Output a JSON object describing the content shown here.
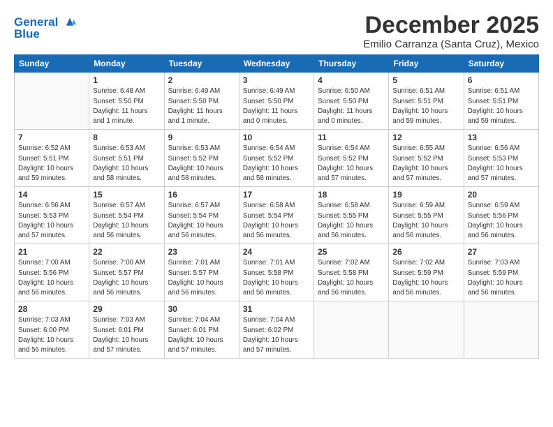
{
  "logo": {
    "line1": "General",
    "line2": "Blue"
  },
  "title": "December 2025",
  "subtitle": "Emilio Carranza (Santa Cruz), Mexico",
  "weekdays": [
    "Sunday",
    "Monday",
    "Tuesday",
    "Wednesday",
    "Thursday",
    "Friday",
    "Saturday"
  ],
  "weeks": [
    [
      {
        "day": "",
        "info": ""
      },
      {
        "day": "1",
        "info": "Sunrise: 6:48 AM\nSunset: 5:50 PM\nDaylight: 11 hours\nand 1 minute."
      },
      {
        "day": "2",
        "info": "Sunrise: 6:49 AM\nSunset: 5:50 PM\nDaylight: 11 hours\nand 1 minute."
      },
      {
        "day": "3",
        "info": "Sunrise: 6:49 AM\nSunset: 5:50 PM\nDaylight: 11 hours\nand 0 minutes."
      },
      {
        "day": "4",
        "info": "Sunrise: 6:50 AM\nSunset: 5:50 PM\nDaylight: 11 hours\nand 0 minutes."
      },
      {
        "day": "5",
        "info": "Sunrise: 6:51 AM\nSunset: 5:51 PM\nDaylight: 10 hours\nand 59 minutes."
      },
      {
        "day": "6",
        "info": "Sunrise: 6:51 AM\nSunset: 5:51 PM\nDaylight: 10 hours\nand 59 minutes."
      }
    ],
    [
      {
        "day": "7",
        "info": "Sunrise: 6:52 AM\nSunset: 5:51 PM\nDaylight: 10 hours\nand 59 minutes."
      },
      {
        "day": "8",
        "info": "Sunrise: 6:53 AM\nSunset: 5:51 PM\nDaylight: 10 hours\nand 58 minutes."
      },
      {
        "day": "9",
        "info": "Sunrise: 6:53 AM\nSunset: 5:52 PM\nDaylight: 10 hours\nand 58 minutes."
      },
      {
        "day": "10",
        "info": "Sunrise: 6:54 AM\nSunset: 5:52 PM\nDaylight: 10 hours\nand 58 minutes."
      },
      {
        "day": "11",
        "info": "Sunrise: 6:54 AM\nSunset: 5:52 PM\nDaylight: 10 hours\nand 57 minutes."
      },
      {
        "day": "12",
        "info": "Sunrise: 6:55 AM\nSunset: 5:52 PM\nDaylight: 10 hours\nand 57 minutes."
      },
      {
        "day": "13",
        "info": "Sunrise: 6:56 AM\nSunset: 5:53 PM\nDaylight: 10 hours\nand 57 minutes."
      }
    ],
    [
      {
        "day": "14",
        "info": "Sunrise: 6:56 AM\nSunset: 5:53 PM\nDaylight: 10 hours\nand 57 minutes."
      },
      {
        "day": "15",
        "info": "Sunrise: 6:57 AM\nSunset: 5:54 PM\nDaylight: 10 hours\nand 56 minutes."
      },
      {
        "day": "16",
        "info": "Sunrise: 6:57 AM\nSunset: 5:54 PM\nDaylight: 10 hours\nand 56 minutes."
      },
      {
        "day": "17",
        "info": "Sunrise: 6:58 AM\nSunset: 5:54 PM\nDaylight: 10 hours\nand 56 minutes."
      },
      {
        "day": "18",
        "info": "Sunrise: 6:58 AM\nSunset: 5:55 PM\nDaylight: 10 hours\nand 56 minutes."
      },
      {
        "day": "19",
        "info": "Sunrise: 6:59 AM\nSunset: 5:55 PM\nDaylight: 10 hours\nand 56 minutes."
      },
      {
        "day": "20",
        "info": "Sunrise: 6:59 AM\nSunset: 5:56 PM\nDaylight: 10 hours\nand 56 minutes."
      }
    ],
    [
      {
        "day": "21",
        "info": "Sunrise: 7:00 AM\nSunset: 5:56 PM\nDaylight: 10 hours\nand 56 minutes."
      },
      {
        "day": "22",
        "info": "Sunrise: 7:00 AM\nSunset: 5:57 PM\nDaylight: 10 hours\nand 56 minutes."
      },
      {
        "day": "23",
        "info": "Sunrise: 7:01 AM\nSunset: 5:57 PM\nDaylight: 10 hours\nand 56 minutes."
      },
      {
        "day": "24",
        "info": "Sunrise: 7:01 AM\nSunset: 5:58 PM\nDaylight: 10 hours\nand 56 minutes."
      },
      {
        "day": "25",
        "info": "Sunrise: 7:02 AM\nSunset: 5:58 PM\nDaylight: 10 hours\nand 56 minutes."
      },
      {
        "day": "26",
        "info": "Sunrise: 7:02 AM\nSunset: 5:59 PM\nDaylight: 10 hours\nand 56 minutes."
      },
      {
        "day": "27",
        "info": "Sunrise: 7:03 AM\nSunset: 5:59 PM\nDaylight: 10 hours\nand 56 minutes."
      }
    ],
    [
      {
        "day": "28",
        "info": "Sunrise: 7:03 AM\nSunset: 6:00 PM\nDaylight: 10 hours\nand 56 minutes."
      },
      {
        "day": "29",
        "info": "Sunrise: 7:03 AM\nSunset: 6:01 PM\nDaylight: 10 hours\nand 57 minutes."
      },
      {
        "day": "30",
        "info": "Sunrise: 7:04 AM\nSunset: 6:01 PM\nDaylight: 10 hours\nand 57 minutes."
      },
      {
        "day": "31",
        "info": "Sunrise: 7:04 AM\nSunset: 6:02 PM\nDaylight: 10 hours\nand 57 minutes."
      },
      {
        "day": "",
        "info": ""
      },
      {
        "day": "",
        "info": ""
      },
      {
        "day": "",
        "info": ""
      }
    ]
  ]
}
